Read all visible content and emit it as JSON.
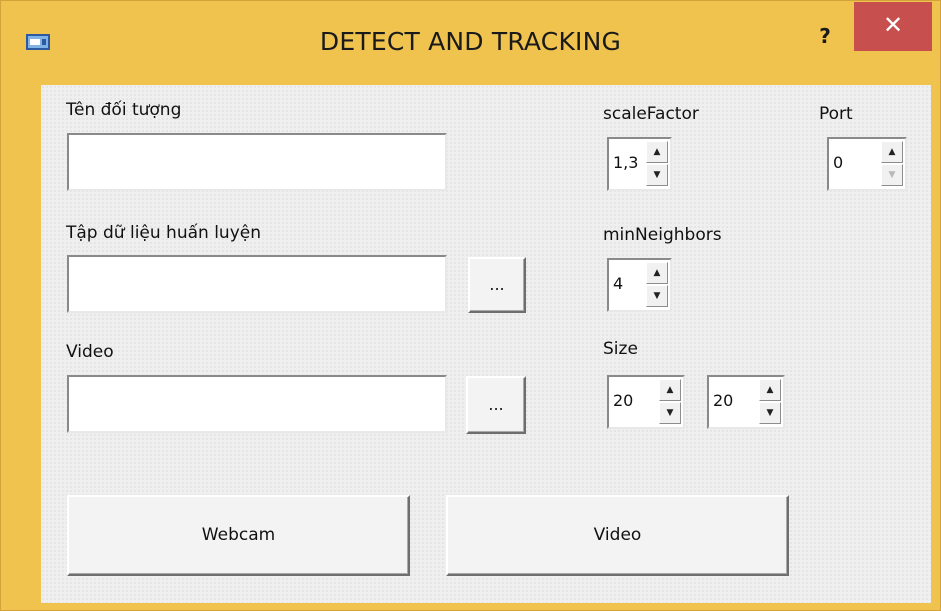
{
  "window": {
    "title": "DETECT AND TRACKING",
    "help_label": "?",
    "close_label": "✕"
  },
  "form": {
    "object_name_label": "Tên đối tượng",
    "object_name_value": "",
    "training_data_label": "Tập dữ liệu huấn luyện",
    "training_data_value": "",
    "training_browse_label": "...",
    "video_label": "Video",
    "video_value": "",
    "video_browse_label": "..."
  },
  "params": {
    "scale_factor_label": "scaleFactor",
    "scale_factor_value": "1,3",
    "port_label": "Port",
    "port_value": "0",
    "min_neighbors_label": "minNeighbors",
    "min_neighbors_value": "4",
    "size_label": "Size",
    "size_width_value": "20",
    "size_height_value": "20",
    "up_arrow": "▲",
    "down_arrow": "▼"
  },
  "actions": {
    "webcam_label": "Webcam",
    "video_label": "Video"
  },
  "colors": {
    "title_bar": "#f0c34f",
    "close_button": "#c7504f",
    "client_bg": "#efefef"
  },
  "icons": {
    "app": "window-app-icon",
    "help": "help-icon",
    "close": "close-icon"
  }
}
